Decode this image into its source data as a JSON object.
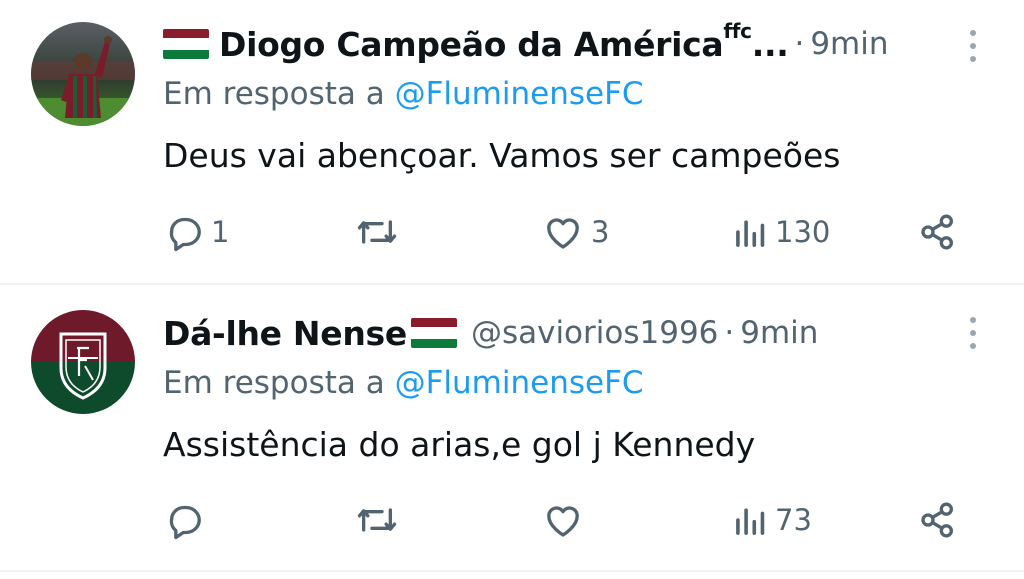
{
  "tweets": [
    {
      "display_name": "Diogo Campeão da América",
      "name_suffix": "ffc",
      "truncation": "...",
      "handle": "",
      "time": "9min",
      "reply_prefix": "Em resposta a",
      "reply_mention": "@FluminenseFC",
      "text": "Deus vai abençoar. Vamos ser campeões",
      "replies": "1",
      "retweets": "",
      "likes": "3",
      "views": "130"
    },
    {
      "display_name": "Dá-lhe Nense",
      "handle": "@saviorios1996",
      "time": "9min",
      "reply_prefix": "Em resposta a",
      "reply_mention": "@FluminenseFC",
      "text": "Assistência do arias,e gol j Kennedy",
      "replies": "",
      "retweets": "",
      "likes": "",
      "views": "73"
    }
  ],
  "separator": "·",
  "icons": {
    "reply": "reply-icon",
    "retweet": "retweet-icon",
    "like": "heart-icon",
    "views": "views-icon",
    "share": "share-icon",
    "more": "more-icon",
    "flag": "fluminense-flag-icon"
  },
  "colors": {
    "link": "#1d9bf0",
    "secondary_text": "#536471",
    "primary_text": "#0f1419",
    "flag_green": "#0b7a3b",
    "flag_maroon": "#8a1c2b",
    "divider": "#eff3f4"
  }
}
